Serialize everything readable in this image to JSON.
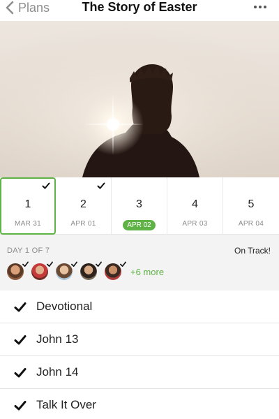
{
  "header": {
    "back_label": "Plans",
    "title": "The Story of Easter",
    "back_icon": "chevron-left-icon",
    "more_icon": "more-horizontal-icon"
  },
  "days": [
    {
      "num": "1",
      "date": "MAR 31",
      "completed": true,
      "selected": true,
      "current": false
    },
    {
      "num": "2",
      "date": "APR 01",
      "completed": true,
      "selected": false,
      "current": false
    },
    {
      "num": "3",
      "date": "APR 02",
      "completed": false,
      "selected": false,
      "current": true
    },
    {
      "num": "4",
      "date": "APR 03",
      "completed": false,
      "selected": false,
      "current": false
    },
    {
      "num": "5",
      "date": "APR 04",
      "completed": false,
      "selected": false,
      "current": false
    }
  ],
  "progress": {
    "day_of": "DAY 1 OF 7",
    "status": "On Track!",
    "more_people": "+6 more",
    "avatar_count": 5
  },
  "items": [
    {
      "label": "Devotional",
      "completed": true
    },
    {
      "label": "John 13",
      "completed": true
    },
    {
      "label": "John 14",
      "completed": true
    },
    {
      "label": "Talk It Over",
      "completed": true
    }
  ],
  "colors": {
    "accent": "#5fb346",
    "background_section": "#f3f3f3",
    "text_muted": "#8a8a8a"
  }
}
